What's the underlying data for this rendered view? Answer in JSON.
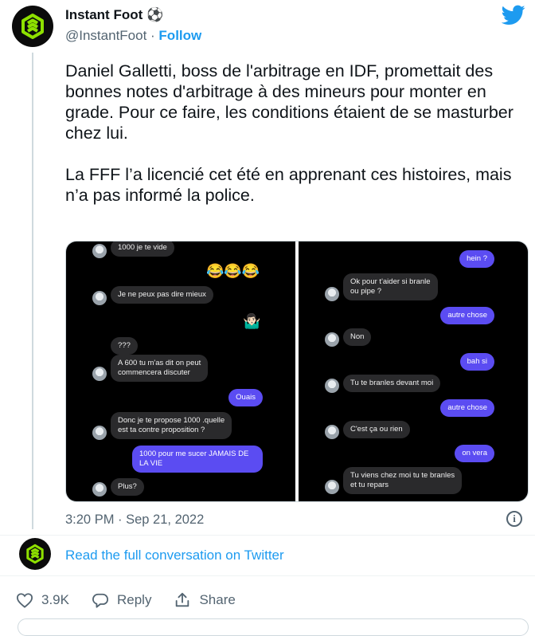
{
  "colors": {
    "accent": "#1d9bf0",
    "bubble_out": "#5b4cf2",
    "bubble_in": "#2a2a2c"
  },
  "author": {
    "display_name": "Instant Foot",
    "name_emoji": "⚽",
    "handle": "@InstantFoot",
    "separator": " · ",
    "follow_label": "Follow"
  },
  "tweet": {
    "paragraph_1": "Daniel Galletti, boss de l'arbitrage en IDF, promettait des bonnes notes d'arbitrage à des mineurs pour monter en grade. Pour ce faire, les conditions étaient de se masturber chez lui.",
    "paragraph_2": "La FFF l’a licencié cet été en apprenant ces histoires, mais n’a pas informé la police.",
    "timestamp": "3:20 PM · Sep 21, 2022"
  },
  "chat_left": {
    "m1": "1000 je te vide",
    "emojis": "😂😂😂",
    "m2": "Je ne peux pas dire mieux",
    "shrug": "🤷🏻‍♂️",
    "m3": "???",
    "m4_l1": "A 600 tu m'as dit on peut",
    "m4_l2": "commencera discuter",
    "m5": "Ouais",
    "m6_l1": "Donc je te propose 1000 .quelle",
    "m6_l2": "est ta contre proposition ?",
    "m7_l1": "1000 pour me sucer JAMAIS DE",
    "m7_l2": "LA VIE",
    "m8": "Plus?"
  },
  "chat_right": {
    "m1": "hein ?",
    "m2_l1": "Ok pour t'aider si branle",
    "m2_l2": "ou pipe ?",
    "m3": "autre chose",
    "m4": "Non",
    "m5": "bah si",
    "m6": "Tu te branles devant moi",
    "m7": "autre chose",
    "m8": "C'est ça ou rien",
    "m9": "on vera",
    "m10_l1": "Tu viens chez moi tu te branles",
    "m10_l2": "et tu repars"
  },
  "footer": {
    "read_more": "Read the full conversation on Twitter",
    "like_count": "3.9K",
    "reply_label": "Reply",
    "share_label": "Share"
  }
}
